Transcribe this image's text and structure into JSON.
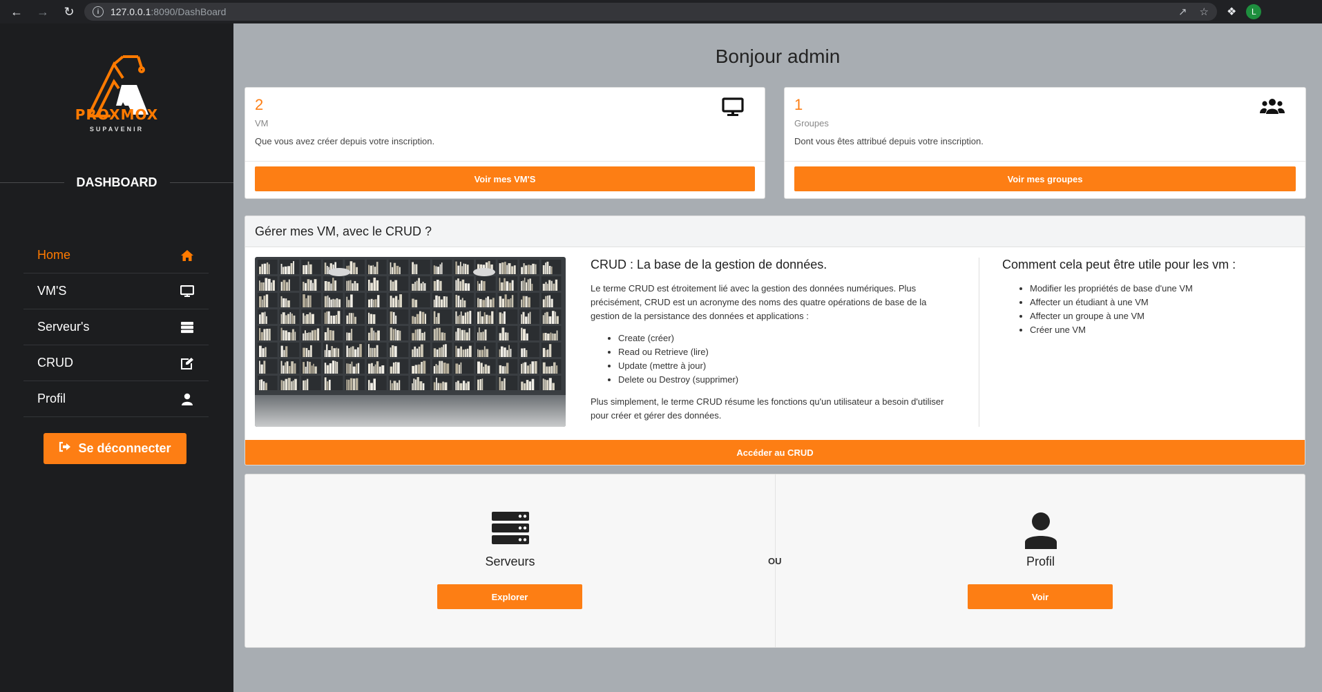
{
  "browser": {
    "host": "127.0.0.1",
    "path": ":8090/DashBoard",
    "profile_initial": "L"
  },
  "sidebar": {
    "brand": "PROXMOX",
    "brand_sub": "SUPAVENIR",
    "section_title": "DASHBOARD",
    "items": [
      {
        "label": "Home",
        "icon": "home-icon"
      },
      {
        "label": "VM'S",
        "icon": "monitor-icon"
      },
      {
        "label": "Serveur's",
        "icon": "server-icon"
      },
      {
        "label": "CRUD",
        "icon": "edit-icon"
      },
      {
        "label": "Profil",
        "icon": "user-icon"
      }
    ],
    "logout_label": "Se déconnecter"
  },
  "colors": {
    "accent": "#fd7e14",
    "sidebar": "#1c1d1f",
    "background": "#a8adb2"
  },
  "main": {
    "greeting": "Bonjour admin",
    "vm_card": {
      "count": "2",
      "label": "VM",
      "description": "Que vous avez créer depuis votre inscription.",
      "button": "Voir mes VM'S",
      "icon": "monitor-icon"
    },
    "group_card": {
      "count": "1",
      "label": "Groupes",
      "description": "Dont vous êtes attribué depuis votre inscription.",
      "button": "Voir mes groupes",
      "icon": "users-icon"
    },
    "crud": {
      "header": "Gérer mes VM, avec le CRUD ?",
      "title": "CRUD : La base de la gestion de données.",
      "intro": "Le terme CRUD est étroitement lié avec la gestion des données numériques. Plus précisément, CRUD est un acronyme des noms des quatre opérations de base de la gestion de la persistance des données et applications :",
      "operations": [
        "Create (créer)",
        "Read ou Retrieve (lire)",
        "Update (mettre à jour)",
        "Delete ou Destroy (supprimer)"
      ],
      "summary": "Plus simplement, le terme CRUD résume les fonctions qu'un utilisateur a besoin d'utiliser pour créer et gérer des données.",
      "useful_title": "Comment cela peut être utile pour les vm :",
      "useful_items": [
        "Modifier les propriétés de base d'une VM",
        "Affecter un étudiant à une VM",
        "Affecter un groupe à une VM",
        "Créer une VM"
      ],
      "button": "Accéder au CRUD"
    },
    "tiles": {
      "servers": {
        "title": "Serveurs",
        "button": "Explorer",
        "icon": "server-icon"
      },
      "separator": "OU",
      "profile": {
        "title": "Profil",
        "button": "Voir",
        "icon": "user-icon"
      }
    }
  }
}
